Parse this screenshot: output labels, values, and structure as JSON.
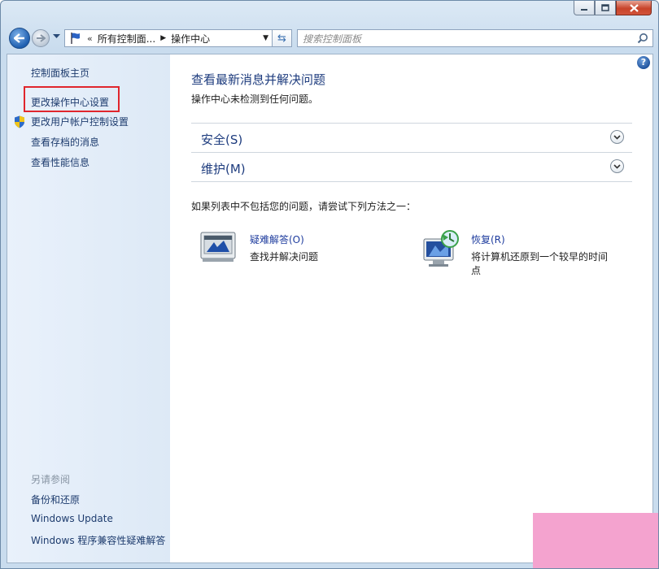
{
  "window": {
    "caption_buttons": [
      {
        "name": "minimize-icon"
      },
      {
        "name": "maximize-icon"
      },
      {
        "name": "close-icon"
      }
    ]
  },
  "navigation": {
    "breadcrumb": {
      "overflow": "«",
      "parent": "所有控制面...",
      "current": "操作中心"
    },
    "search_placeholder": "搜索控制面板"
  },
  "sidebar": {
    "home": "控制面板主页",
    "links": [
      "更改操作中心设置",
      "更改用户帐户控制设置",
      "查看存档的消息",
      "查看性能信息"
    ],
    "see_also_title": "另请参阅",
    "related": [
      "备份和还原",
      "Windows Update",
      "Windows 程序兼容性疑难解答"
    ]
  },
  "main": {
    "title": "查看最新消息并解决问题",
    "subtitle": "操作中心未检测到任何问题。",
    "sections": [
      {
        "label": "安全(S)"
      },
      {
        "label": "维护(M)"
      }
    ],
    "hint": "如果列表中不包括您的问题，请尝试下列方法之一：",
    "tools": [
      {
        "label": "疑难解答(O)",
        "desc": "查找并解决问题"
      },
      {
        "label": "恢复(R)",
        "desc": "将计算机还原到一个较早的时间点"
      }
    ]
  },
  "colors": {
    "link": "#1e3c6e",
    "highlight_box": "#e0262d",
    "watermark": "#f4a3cf"
  }
}
